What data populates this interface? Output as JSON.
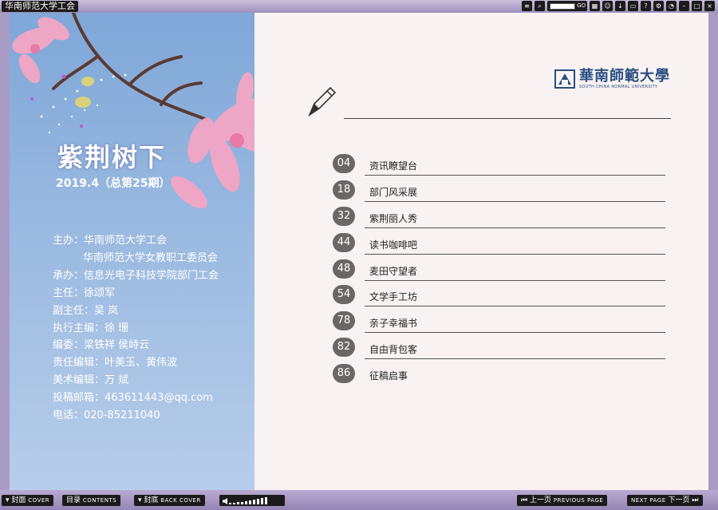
{
  "window": {
    "title": "华南师范大学工会"
  },
  "toolbar": {
    "icons": [
      "list-icon",
      "zoom-icon",
      "page-go-field",
      "thumbnails-icon",
      "user-icon",
      "download-icon",
      "print-icon",
      "help-icon",
      "settings-icon",
      "auto-flip-icon",
      "minimize-icon",
      "maximize-icon",
      "close-icon"
    ],
    "go_label": "GO"
  },
  "left_page": {
    "title": "紫荆树下",
    "issue": "2019.4（总第25期）",
    "credits": [
      {
        "text": "主办：华南师范大学工会",
        "indent": false
      },
      {
        "text": "华南师范大学女教职工委员会",
        "indent": true
      },
      {
        "text": "承办：信息光电子科技学院部门工会",
        "indent": false
      },
      {
        "text": "主任：徐颂军",
        "indent": false
      },
      {
        "text": "副主任：吴 岚",
        "indent": false
      },
      {
        "text": "执行主编：徐 珊",
        "indent": false
      },
      {
        "text": "编委：梁铁祥  侯峙云",
        "indent": false
      },
      {
        "text": "责任编辑：叶美玉、黄伟波",
        "indent": false
      },
      {
        "text": "美术编辑：万 斌",
        "indent": false
      },
      {
        "text": "投稿邮箱：463611443@qq.com",
        "indent": false
      },
      {
        "text": "电话：020-85211040",
        "indent": false
      }
    ]
  },
  "right_page": {
    "logo_cn": "華南師範大學",
    "logo_en": "SOUTH CHINA NORMAL UNIVERSITY",
    "toc": [
      {
        "page": "04",
        "label": "资讯瞭望台"
      },
      {
        "page": "18",
        "label": "部门风采展"
      },
      {
        "page": "32",
        "label": "紫荆丽人秀"
      },
      {
        "page": "44",
        "label": "读书咖啡吧"
      },
      {
        "page": "48",
        "label": "麦田守望者"
      },
      {
        "page": "54",
        "label": "文学手工坊"
      },
      {
        "page": "78",
        "label": "亲子幸福书"
      },
      {
        "page": "82",
        "label": "自由背包客"
      },
      {
        "page": "86",
        "label": "征稿启事"
      }
    ]
  },
  "bottombar": {
    "cover": {
      "cn": "封面",
      "en": "COVER"
    },
    "contents": {
      "cn": "目录",
      "en": "CONTENTS"
    },
    "back_cover": {
      "cn": "封底",
      "en": "BACK COVER"
    },
    "previous": {
      "cn": "上一页",
      "en": "PREVIOUS PAGE"
    },
    "next": {
      "en": "NEXT PAGE",
      "cn": "下一页"
    }
  },
  "colors": {
    "left_page_top": "#7fa7d8",
    "right_page_bg": "#f8f2f2",
    "toc_badge": "#6b6767",
    "logo_blue": "#2a4f82",
    "chrome": "#a99cc4"
  }
}
